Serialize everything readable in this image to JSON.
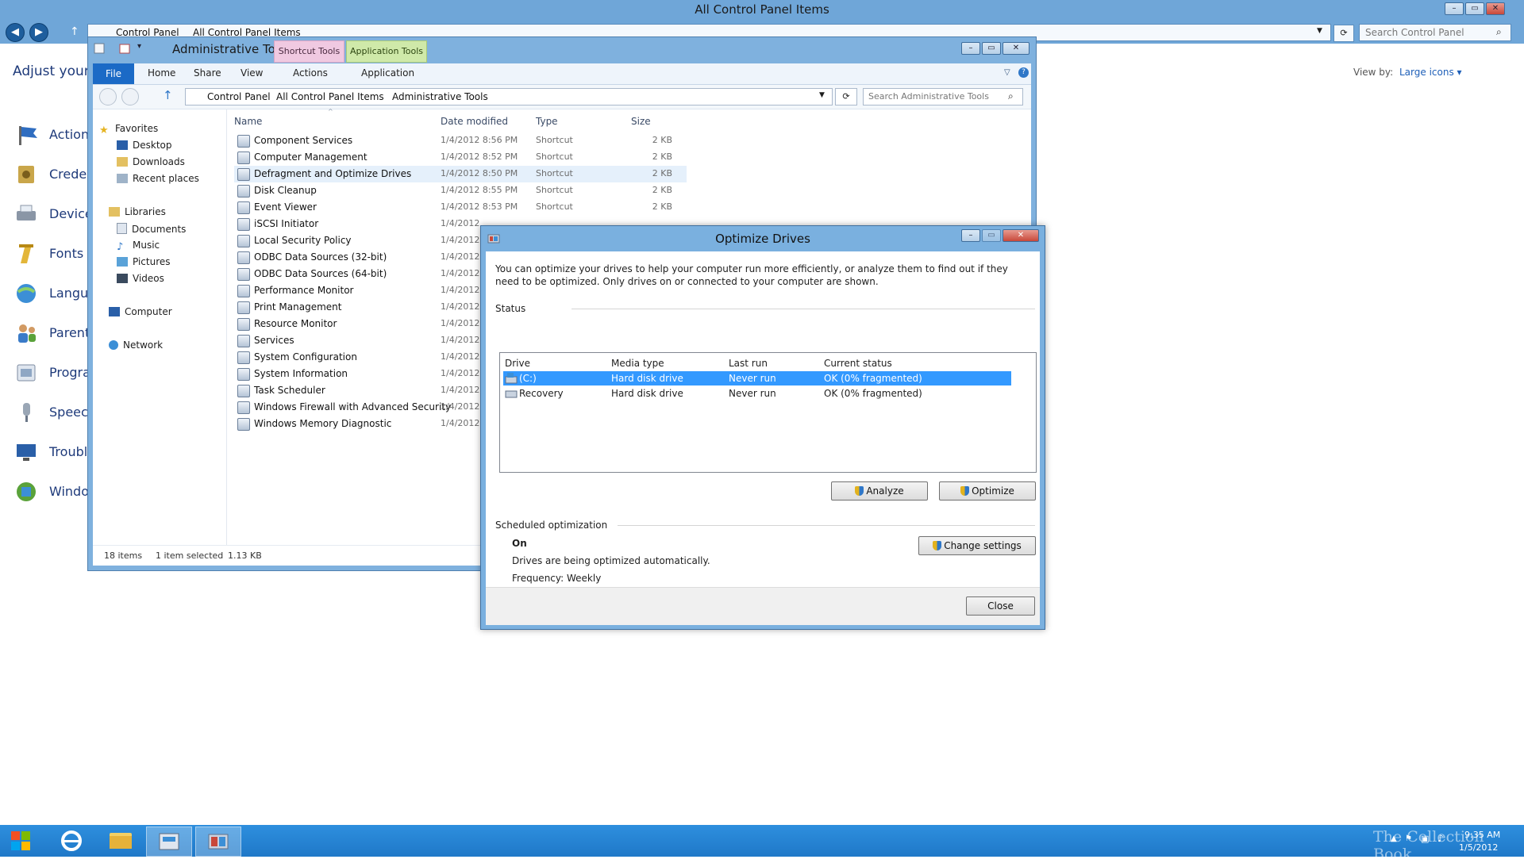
{
  "control_panel": {
    "title": "All Control Panel Items",
    "breadcrumb": [
      "Control Panel",
      "All Control Panel Items"
    ],
    "search_placeholder": "Search Control Panel",
    "subheading": "Adjust your c",
    "view_by_label": "View by:",
    "view_by_value": "Large icons",
    "items": [
      "Action",
      "Creden",
      "Devices",
      "Fonts",
      "Langua",
      "Parenta",
      "Progra",
      "Speech",
      "Trouble",
      "Windo"
    ]
  },
  "explorer": {
    "title": "Administrative To...",
    "context_tabs": {
      "shortcut": "Shortcut Tools",
      "application": "Application Tools"
    },
    "ribbon_tabs": {
      "file": "File",
      "home": "Home",
      "share": "Share",
      "view": "View",
      "actions": "Actions",
      "application": "Application"
    },
    "breadcrumb": [
      "Control Panel",
      "All Control Panel Items",
      "Administrative Tools"
    ],
    "search_placeholder": "Search Administrative Tools",
    "nav": {
      "favorites": "Favorites",
      "desktop": "Desktop",
      "downloads": "Downloads",
      "recent": "Recent places",
      "libraries": "Libraries",
      "documents": "Documents",
      "music": "Music",
      "pictures": "Pictures",
      "videos": "Videos",
      "computer": "Computer",
      "network": "Network"
    },
    "columns": {
      "name": "Name",
      "date": "Date modified",
      "type": "Type",
      "size": "Size"
    },
    "rows": [
      {
        "name": "Component Services",
        "date": "1/4/2012 8:56 PM",
        "type": "Shortcut",
        "size": "2 KB"
      },
      {
        "name": "Computer Management",
        "date": "1/4/2012 8:52 PM",
        "type": "Shortcut",
        "size": "2 KB"
      },
      {
        "name": "Defragment and Optimize Drives",
        "date": "1/4/2012 8:50 PM",
        "type": "Shortcut",
        "size": "2 KB"
      },
      {
        "name": "Disk Cleanup",
        "date": "1/4/2012 8:55 PM",
        "type": "Shortcut",
        "size": "2 KB"
      },
      {
        "name": "Event Viewer",
        "date": "1/4/2012 8:53 PM",
        "type": "Shortcut",
        "size": "2 KB"
      },
      {
        "name": "iSCSI Initiator",
        "date": "1/4/2012",
        "type": "",
        "size": ""
      },
      {
        "name": "Local Security Policy",
        "date": "1/4/2012",
        "type": "",
        "size": ""
      },
      {
        "name": "ODBC Data Sources (32-bit)",
        "date": "1/4/2012",
        "type": "",
        "size": ""
      },
      {
        "name": "ODBC Data Sources (64-bit)",
        "date": "1/4/2012",
        "type": "",
        "size": ""
      },
      {
        "name": "Performance Monitor",
        "date": "1/4/2012",
        "type": "",
        "size": ""
      },
      {
        "name": "Print Management",
        "date": "1/4/2012",
        "type": "",
        "size": ""
      },
      {
        "name": "Resource Monitor",
        "date": "1/4/2012",
        "type": "",
        "size": ""
      },
      {
        "name": "Services",
        "date": "1/4/2012",
        "type": "",
        "size": ""
      },
      {
        "name": "System Configuration",
        "date": "1/4/2012",
        "type": "",
        "size": ""
      },
      {
        "name": "System Information",
        "date": "1/4/2012",
        "type": "",
        "size": ""
      },
      {
        "name": "Task Scheduler",
        "date": "1/4/2012",
        "type": "",
        "size": ""
      },
      {
        "name": "Windows Firewall with Advanced Security",
        "date": "1/4/2012",
        "type": "",
        "size": ""
      },
      {
        "name": "Windows Memory Diagnostic",
        "date": "1/4/2012",
        "type": "",
        "size": ""
      }
    ],
    "status": {
      "count": "18 items",
      "selected": "1 item selected",
      "size": "1.13 KB"
    }
  },
  "dialog": {
    "title": "Optimize Drives",
    "description": "You can optimize your drives to help your computer run more efficiently, or analyze them to find out if they need to be optimized. Only drives on or connected to your computer are shown.",
    "status_label": "Status",
    "columns": {
      "drive": "Drive",
      "media": "Media type",
      "last_run": "Last run",
      "status": "Current status"
    },
    "drives": [
      {
        "drive": "(C:)",
        "media": "Hard disk drive",
        "last_run": "Never run",
        "status": "OK (0% fragmented)"
      },
      {
        "drive": "Recovery",
        "media": "Hard disk drive",
        "last_run": "Never run",
        "status": "OK (0% fragmented)"
      }
    ],
    "analyze_label": "Analyze",
    "optimize_label": "Optimize",
    "scheduled_label": "Scheduled optimization",
    "sched_state": "On",
    "sched_desc": "Drives are being optimized automatically.",
    "sched_freq": "Frequency: Weekly",
    "change_settings_label": "Change settings",
    "close_label": "Close"
  },
  "taskbar": {
    "time": "9:35 AM",
    "date": "1/5/2012",
    "watermark": "The Collection Book"
  },
  "colors": {
    "accent": "#1b6ac6",
    "selection": "#3399ff",
    "taskbar": "#2a86d6"
  }
}
